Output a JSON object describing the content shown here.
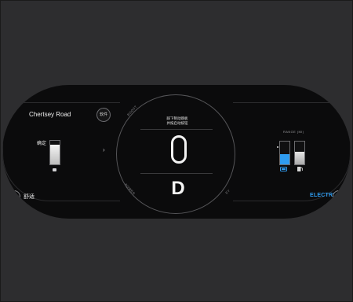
{
  "left_panel": {
    "road_name": "Chertsey Road",
    "software_button": "软件",
    "confirm_label": "确定",
    "fuel_level": 0.85,
    "chevron": "›"
  },
  "center_panel": {
    "nav_hint_line1": "踩下制动踏板",
    "nav_hint_line2": "并按启动按钮",
    "gear": "D",
    "ring_left_top": "BOOST",
    "ring_left_bottom": "POWER",
    "ring_right_bottom": "EV"
  },
  "right_panel": {
    "range_label": "RANGE (MI)",
    "battery_level": 0.45,
    "fuel_level": 0.55,
    "battery_icon": "battery-charge-icon",
    "fuel_icon": "fuel-pump-icon",
    "colors": {
      "battery": "#2f9cf0",
      "fuel": "#d6d6d6"
    }
  },
  "modes": {
    "left_letter": "H",
    "left_mode_text": "舒适",
    "right_letter": "P",
    "right_mode_text": "ELECTRIC",
    "accent_color": "#2f9cf0"
  }
}
